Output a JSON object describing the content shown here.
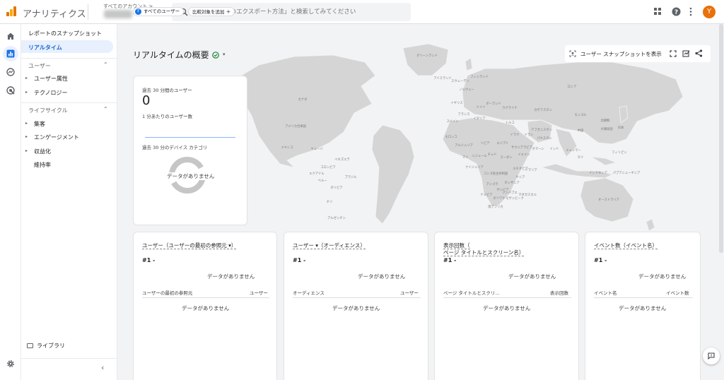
{
  "app": {
    "title": "アナリティクス"
  },
  "account": {
    "label": "すべてのアカウント >",
    "property": "- GA4"
  },
  "search": {
    "placeholder": "「BigQuery のエクスポート方法」と検索してみてください"
  },
  "user": {
    "initial": "Y"
  },
  "sidebar": {
    "items": [
      {
        "label": "レポートのスナップショット"
      },
      {
        "label": "リアルタイム"
      }
    ],
    "group_user": "ユーザー",
    "user_items": [
      "ユーザー属性",
      "テクノロジー"
    ],
    "group_lifecycle": "ライフサイクル",
    "lifecycle_items": [
      "集客",
      "エンゲージメント",
      "収益化",
      "維持率"
    ],
    "library": "ライブラリ"
  },
  "filters": {
    "segment_badge": "す",
    "segment": "すべてのユーザー",
    "compare": "比較対象を追加"
  },
  "page": {
    "title": "リアルタイムの概要"
  },
  "actions": {
    "snapshot": "ユーザー スナップショットを表示"
  },
  "summary": {
    "users_label": "過去 30 分間のユーザー",
    "users_value": "0",
    "per_minute": "1 分あたりのユーザー数",
    "device_label": "過去 30 分のデバイス カテゴリ",
    "device_nodata": "データがありません"
  },
  "cards": [
    {
      "title": "ユーザー（ユーザーの最初の参照元 ▾）",
      "rank": "#1  -",
      "nodata": "データがありません",
      "col1": "ユーザーの最初の参照元",
      "col2": "ユーザー",
      "table_nodata": "データがありません"
    },
    {
      "title": "ユーザー ▾（オーディエンス）",
      "rank": "#1  -",
      "nodata": "データがありません",
      "col1": "オーディエンス",
      "col2": "ユーザー",
      "table_nodata": "データがありません"
    },
    {
      "title": "表示回数（",
      "title2": "ページ タイトルとスクリーン名）",
      "rank": "#1  -",
      "nodata": "データがありません",
      "col1": "ページ タイトルとスクリ...",
      "col2": "表示回数",
      "table_nodata": "データがありません"
    },
    {
      "title": "イベント数（イベント名）",
      "rank": "#1  -",
      "nodata": "データがありません",
      "col1": "イベント名",
      "col2": "イベント数",
      "table_nodata": "データがありません"
    }
  ],
  "map_labels": [
    {
      "text": "グリーンランド"
    },
    {
      "text": "アイスランド"
    },
    {
      "text": "スウェーデン"
    },
    {
      "text": "フィンランド"
    },
    {
      "text": "ノルウェー"
    },
    {
      "text": "ロシア"
    },
    {
      "text": "カナダ"
    },
    {
      "text": "イギリス"
    },
    {
      "text": "ポーランド"
    },
    {
      "text": "ドイツ"
    },
    {
      "text": "ウクライナ"
    },
    {
      "text": "フランス"
    },
    {
      "text": "スペイン"
    },
    {
      "text": "イタリア"
    },
    {
      "text": "トルコ"
    },
    {
      "text": "カザフスタン"
    },
    {
      "text": "モンゴル"
    },
    {
      "text": "アメリカ合衆国"
    },
    {
      "text": "中国"
    },
    {
      "text": "日本"
    },
    {
      "text": "大韓民国"
    },
    {
      "text": "北朝鮮"
    },
    {
      "text": "アフガニスタン"
    },
    {
      "text": "イラン"
    },
    {
      "text": "イラク"
    },
    {
      "text": "パキスタン"
    },
    {
      "text": "インド"
    },
    {
      "text": "モロッコ"
    },
    {
      "text": "アルジェリア"
    },
    {
      "text": "リビア"
    },
    {
      "text": "エジプト"
    },
    {
      "text": "サウジアラビア"
    },
    {
      "text": "メキシコ"
    },
    {
      "text": "キューバ"
    },
    {
      "text": "マリ"
    },
    {
      "text": "ニジェール"
    },
    {
      "text": "チャド"
    },
    {
      "text": "スーダン"
    },
    {
      "text": "ミャンマー"
    },
    {
      "text": "タイ"
    },
    {
      "text": "フィリピン"
    },
    {
      "text": "ベネズエラ"
    },
    {
      "text": "コロンビア"
    },
    {
      "text": "ナイジェリア"
    },
    {
      "text": "エチオピア"
    },
    {
      "text": "ケニア"
    },
    {
      "text": "インドネシア"
    },
    {
      "text": "パプアニューギニア"
    },
    {
      "text": "ペルー"
    },
    {
      "text": "ブラジル"
    },
    {
      "text": "ボリビア"
    },
    {
      "text": "コンゴ民主共和国"
    },
    {
      "text": "タンザニア"
    },
    {
      "text": "アンゴラ"
    },
    {
      "text": "ザンビア"
    },
    {
      "text": "マダガスカル"
    },
    {
      "text": "ナミビア"
    },
    {
      "text": "チリ"
    },
    {
      "text": "アルゼンチン"
    },
    {
      "text": "南アフリカ"
    },
    {
      "text": "オーストラリア"
    },
    {
      "text": "ニュージーランド"
    },
    {
      "text": "エクアドル"
    },
    {
      "text": "ボツワナ"
    },
    {
      "text": "モザンビーク"
    },
    {
      "text": "ジンバブエ"
    },
    {
      "text": "ソマリア"
    },
    {
      "text": "オマーン"
    },
    {
      "text": "イエメン"
    }
  ]
}
